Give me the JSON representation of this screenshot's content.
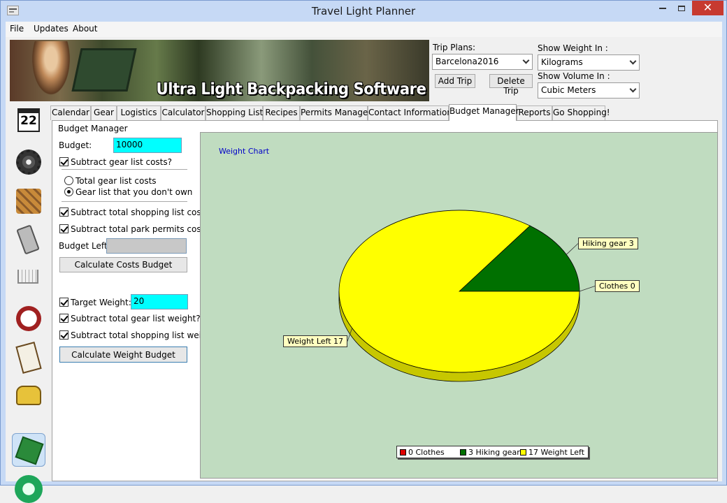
{
  "window": {
    "title": "Travel Light Planner",
    "controls": {
      "minimize": "minimize-icon",
      "maximize": "maximize-icon",
      "close": "✕"
    }
  },
  "menu": [
    "File",
    "Updates",
    "About"
  ],
  "banner": {
    "text": "Ultra Light Backpacking Software"
  },
  "trip": {
    "label": "Trip Plans:",
    "selected": "Barcelona2016",
    "add_label": "Add Trip",
    "delete_label": "Delete Trip"
  },
  "units": {
    "weight_label": "Show Weight In :",
    "weight_selected": "Kilograms",
    "volume_label": "Show Volume In :",
    "volume_selected": "Cubic Meters"
  },
  "sidebar": {
    "icons": [
      "calendar-icon",
      "gear-icon",
      "map-icon",
      "calculator-icon",
      "shopping-cart-icon",
      "chef-icon",
      "clipboard-icon",
      "phone-icon",
      "money-icon",
      "mail-icon"
    ],
    "calendar_day": "22",
    "active_index": 8
  },
  "tabs": [
    {
      "label": "Calendar"
    },
    {
      "label": "Gear"
    },
    {
      "label": "Logistics"
    },
    {
      "label": "Calculator"
    },
    {
      "label": "Shopping List"
    },
    {
      "label": "Recipes"
    },
    {
      "label": "Permits Manager"
    },
    {
      "label": "Contact Information"
    },
    {
      "label": "Budget Manager"
    },
    {
      "label": "Reports"
    },
    {
      "label": "Go Shopping!"
    }
  ],
  "active_tab": "Budget Manager",
  "budget": {
    "group_title": "Budget Manager",
    "budget_label": "Budget:",
    "budget_value": "10000",
    "subtract_gear_label": "Subtract gear list costs?",
    "subtract_gear_checked": true,
    "radio_total_label": "Total gear list costs",
    "radio_owned_label": "Gear list that you don't own",
    "radio_selected": "owned",
    "subtract_shopping_label": "Subtract total shopping list costs?",
    "subtract_shopping_checked": true,
    "subtract_permits_label": "Subtract total park permits costs?",
    "subtract_permits_checked": true,
    "budget_left_label": "Budget Left:",
    "budget_left_value": "",
    "calc_costs_label": "Calculate Costs Budget",
    "target_weight_label": "Target Weight:",
    "target_weight_checked": true,
    "target_weight_value": "20",
    "subtract_gear_weight_label": "Subtract total gear list weight?",
    "subtract_gear_weight_checked": true,
    "subtract_shopping_weight_label": "Subtract total shopping list weight?",
    "subtract_shopping_weight_checked": true,
    "calc_weight_label": "Calculate Weight Budget"
  },
  "chart_data": {
    "type": "pie",
    "title": "Weight Chart",
    "categories": [
      "Clothes",
      "Hiking gear",
      "Weight Left"
    ],
    "values": [
      0,
      3,
      17
    ],
    "colors": [
      "#e00000",
      "#007000",
      "#ffff00"
    ],
    "callouts": [
      "Clothes 0",
      "Hiking gear 3",
      "Weight Left 17"
    ],
    "legend": [
      "0 Clothes",
      "3 Hiking gear",
      "17 Weight Left"
    ],
    "legend_position": "bottom-center",
    "three_d": true
  }
}
